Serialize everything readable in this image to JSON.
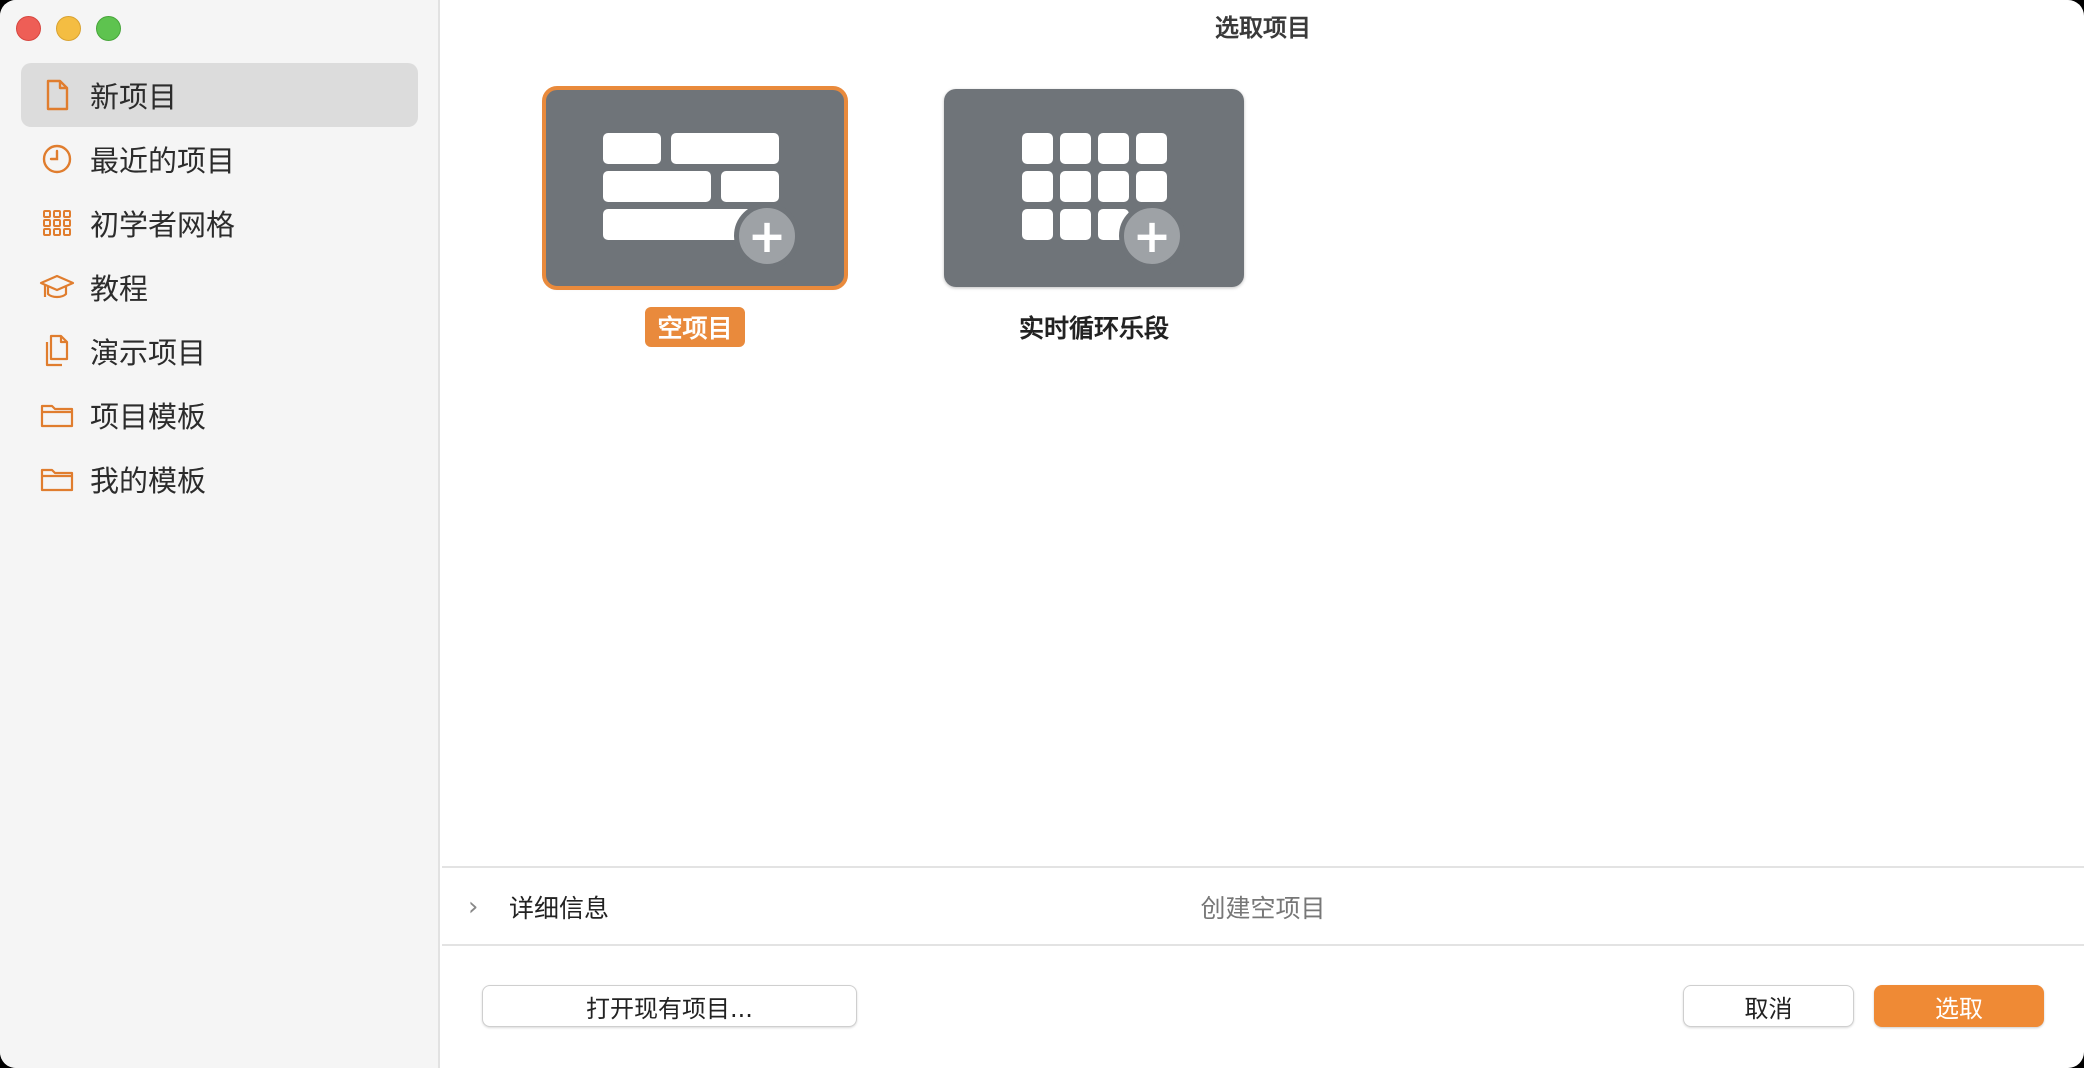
{
  "window": {
    "title": "选取项目"
  },
  "colors": {
    "accent": "#ef8a35",
    "tile_bg": "#6f7479",
    "sidebar_bg": "#f5f5f5"
  },
  "sidebar": {
    "items": [
      {
        "label": "新项目",
        "icon": "document-icon",
        "active": true
      },
      {
        "label": "最近的项目",
        "icon": "clock-icon",
        "active": false
      },
      {
        "label": "初学者网格",
        "icon": "grid-icon",
        "active": false
      },
      {
        "label": "教程",
        "icon": "graduation-cap-icon",
        "active": false
      },
      {
        "label": "演示项目",
        "icon": "documents-icon",
        "active": false
      },
      {
        "label": "项目模板",
        "icon": "folder-icon",
        "active": false
      },
      {
        "label": "我的模板",
        "icon": "folder-icon",
        "active": false
      }
    ]
  },
  "templates": [
    {
      "label": "空项目",
      "selected": true
    },
    {
      "label": "实时循环乐段",
      "selected": false
    }
  ],
  "details": {
    "label": "详细信息",
    "description": "创建空项目"
  },
  "footer": {
    "open_existing": "打开现有项目...",
    "cancel": "取消",
    "choose": "选取"
  }
}
